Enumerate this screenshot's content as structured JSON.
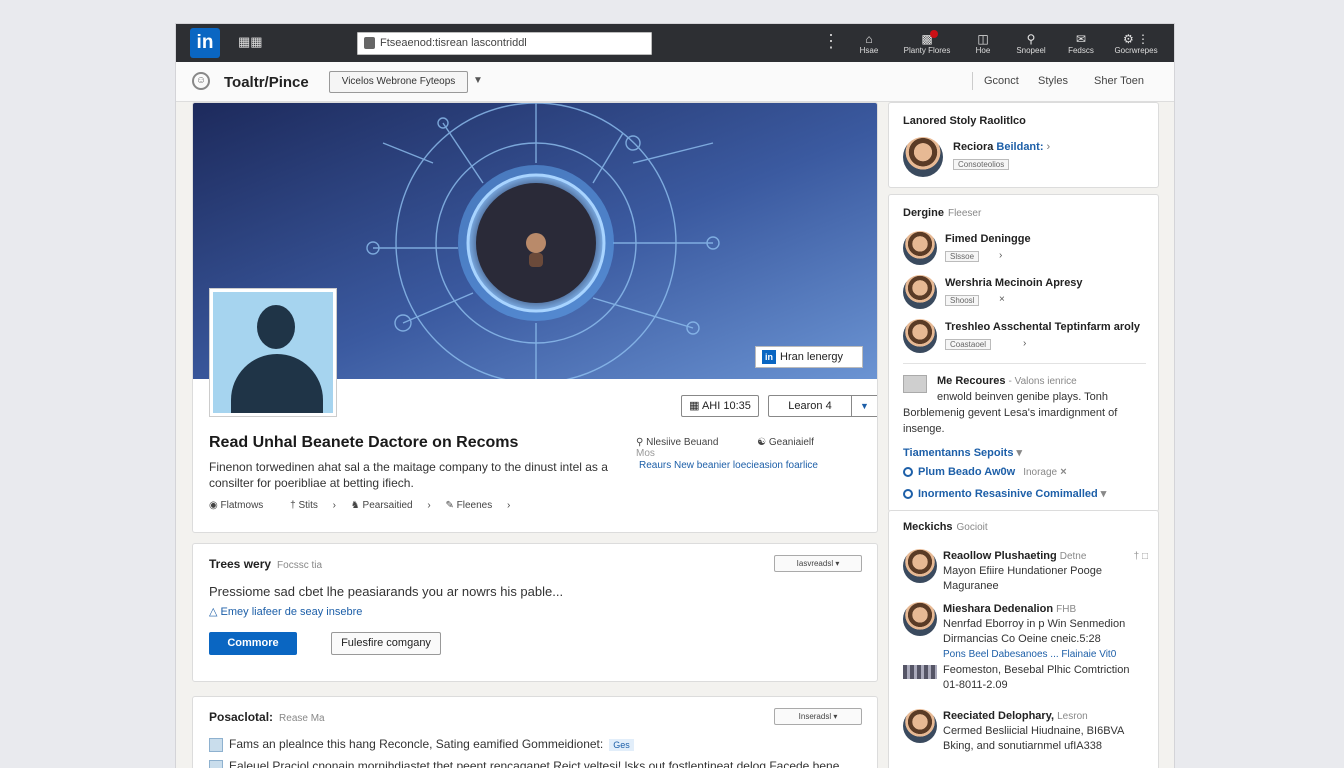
{
  "topnav": {
    "logo": "in",
    "search_value": "Ftseaenod:tisrean lascontriddl",
    "items": [
      {
        "label": "Hsae",
        "icon": "home-icon"
      },
      {
        "label": "Planty Flores",
        "icon": "network-icon"
      },
      {
        "label": "Hoe",
        "icon": "jobs-icon"
      },
      {
        "label": "Snopeel",
        "icon": "search-icon"
      },
      {
        "label": "Fedscs",
        "icon": "messaging-icon"
      },
      {
        "label": "Gocrwrepes",
        "icon": "notifications-icon"
      }
    ]
  },
  "subbar": {
    "page_name": "Toaltr/Pince",
    "dropdown": "Vicelos Webrone Fyteops",
    "links": [
      "Gconct",
      "Styles",
      "Sher Toen"
    ]
  },
  "main": {
    "cover_button": "Hran lenergy",
    "btn_follow": "AHI 10:35",
    "btn_learn": "Learon 4",
    "title": "Read Unhal Beanete Dactore on Recoms",
    "description": "Finenon torwedinen ahat sal a the maitage company to the dinust intel as a consilter for poeribliae at betting ifiech.",
    "meta": [
      "Flatmows",
      "Stits",
      "Pearsaitied",
      "Fleenes"
    ],
    "right_meta": [
      "Nlesiive Beuand",
      "Geaniaielf",
      "Mos"
    ],
    "right_link": "Reaurs New beanier loecieasion foarlice"
  },
  "story": {
    "heading": "Trees wery",
    "sub": "Focssc tia",
    "dropdown": "Iasvreadsl",
    "text": "Pressiome sad cbet lhe peasiarands you ar nowrs his pable...",
    "link": "Emey liafeer de seay insebre",
    "btn_primary": "Commore",
    "btn_secondary": "Fulesfire comgany"
  },
  "post": {
    "heading": "Posaclotal:",
    "sub": "Rease Ma",
    "dropdown": "Inseradsl",
    "rows": [
      {
        "text": "Fams an plealnce this hang Reconcle, Sating eamified Gommeidionet:",
        "tag": "Ges"
      },
      {
        "text": "Ealeuel Praciol cnonain mornihdiastet thet peent rencaganet Reict veltesi! lsks out fostlentineat delog Facede bene",
        "tag": ""
      }
    ]
  },
  "r1": {
    "heading": "Lanored Stoly Raolitlco",
    "name": "Reciora",
    "name_link": "Beildant:",
    "tag": "Consoteolios"
  },
  "r2": {
    "heading": "Dergine",
    "heading_sub": "Fleeser",
    "people": [
      {
        "name": "Fimed Deningge",
        "tag": "Slssoe"
      },
      {
        "name": "Wershria Mecinoin Apresy",
        "tag": "Shoosl"
      },
      {
        "name": "Treshleo Asschental Teptinfarm aroly",
        "tag": "Coastaoel"
      }
    ],
    "note_title": "Me Recoures",
    "note_sub": "Valons ienrice",
    "note_text": "enwold beinven genibe plays. Tonh Borblemenig gevent Lesa's imardignment of insenge.",
    "links": [
      {
        "text": "Tiamentanns Sepoits",
        "extra": ""
      },
      {
        "text": "Plum Beado Aw0w",
        "extra": "Inorage"
      },
      {
        "text": "Inormento Resasinive Comimalled",
        "extra": ""
      }
    ]
  },
  "r3": {
    "heading": "Meckichs",
    "heading_sub": "Gocioit",
    "items": [
      {
        "title": "Reaollow Plushaeting",
        "extra": "Detne",
        "line2": "Mayon Efiire Hundationer Pooge",
        "line3": "Maguranee",
        "line4": ""
      },
      {
        "title": "Mieshara Dedenalion",
        "extra": "FHB",
        "line2": "Nenrfad Eborroy in p Win Senmedion",
        "line3": "Dirmancias Co Oeine cneic.5:28",
        "line4": "Pons Beel Dabesanoes ... Flainaie Vit0"
      },
      {
        "title": "",
        "extra": "",
        "line2": "Feomeston, Besebal Plhic Comtriction",
        "line3": "01-8011-2.09",
        "line4": ""
      },
      {
        "title": "Reeciated Delophary,",
        "extra": "Lesron",
        "line2": "Cermed Besliicial Hiudnaine, BI6BVA",
        "line3": "Bking, and sonutiarnmel ufIA338",
        "line4": ""
      }
    ]
  },
  "colors": {
    "accent": "#0a66c2",
    "nav": "#2d2f33",
    "cover_dark": "#1d2a5c",
    "cover_light": "#5f86c9"
  }
}
